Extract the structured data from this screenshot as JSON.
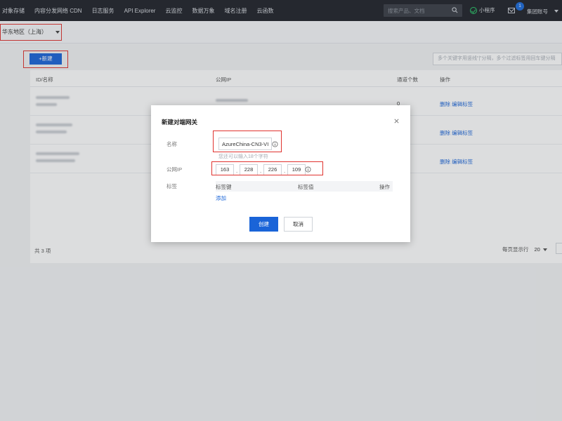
{
  "topnav": {
    "items": [
      "对象存储",
      "内容分发网络 CDN",
      "日志服务",
      "API Explorer",
      "云监控",
      "数据万象",
      "域名注册",
      "云函数"
    ],
    "search_placeholder": "搜索产品、文档",
    "mini_program": "小程序",
    "notification_count": "1",
    "account": "集团账号"
  },
  "region": {
    "label": "华东地区（上海）"
  },
  "toolbar": {
    "new_button": "+新建",
    "filter_placeholder": "多个关键字用竖线“|”分隔，多个过滤标签用回车键分隔"
  },
  "table": {
    "headers": {
      "id_name": "ID/名称",
      "public_ip": "公网IP",
      "tunnel_count": "通道个数",
      "actions": "操作"
    },
    "rows": [
      {
        "tunnel_count": "0",
        "actions": "删除 编辑标签"
      },
      {
        "tunnel_count": "",
        "actions": "删除 编辑标签"
      },
      {
        "tunnel_count": "",
        "actions": "删除 编辑标签"
      }
    ],
    "total": "共 3 项",
    "per_page_label": "每页显示行",
    "per_page_value": "20"
  },
  "modal": {
    "title": "新建对端网关",
    "name_label": "名称",
    "name_value": "AzureChina-CN3-VI",
    "name_hint": "您还可以输入18个字符",
    "ip_label": "公网IP",
    "ip_octets": [
      "163",
      "228",
      "226",
      "109"
    ],
    "ip_separator": ".",
    "tag_label": "标签",
    "tag_key_header": "标签键",
    "tag_value_header": "标签值",
    "tag_action_header": "操作",
    "add_link": "添加",
    "create_button": "创建",
    "cancel_button": "取消"
  },
  "colors": {
    "primary": "#1a64d8",
    "highlight_box": "#e0332f",
    "nav_bg": "#20232a",
    "success": "#29cc6a"
  }
}
